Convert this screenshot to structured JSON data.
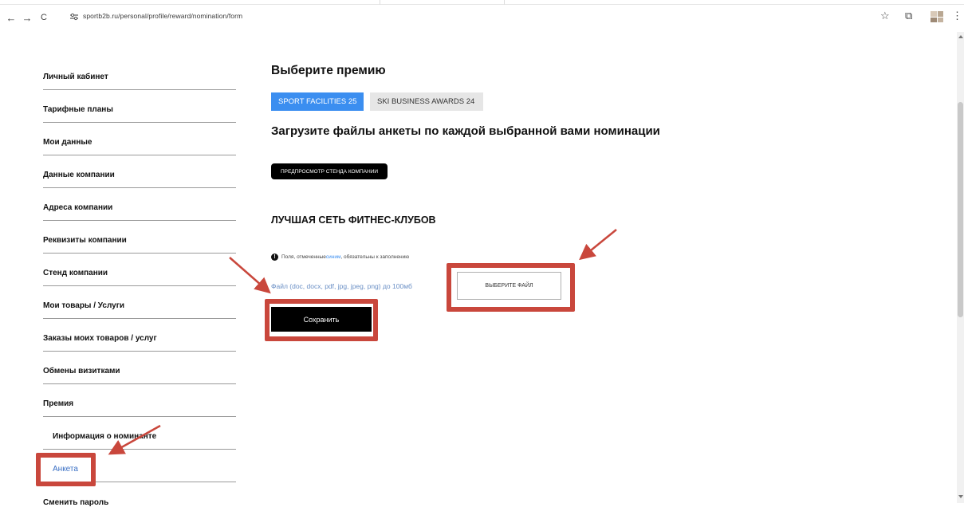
{
  "browser": {
    "url": "sportb2b.ru/personal/profile/reward/nomination/form",
    "back_icon": "←",
    "forward_icon": "→",
    "reload_icon": "C",
    "star_icon": "☆",
    "extensions_icon": "⧉",
    "menu_icon": "⋮"
  },
  "sidebar": {
    "items": [
      {
        "label": "Личный кабинет"
      },
      {
        "label": "Тарифные планы"
      },
      {
        "label": "Мои данные"
      },
      {
        "label": "Данные компании"
      },
      {
        "label": "Адреса компании"
      },
      {
        "label": "Реквизиты компании"
      },
      {
        "label": "Стенд компании"
      },
      {
        "label": "Мои товары / Услуги"
      },
      {
        "label": "Заказы моих товаров / услуг"
      },
      {
        "label": "Обмены визитками"
      },
      {
        "label": "Премия"
      },
      {
        "label": "Информация о номинанте"
      },
      {
        "label": "Анкета"
      },
      {
        "label": "Сменить пароль"
      }
    ]
  },
  "main": {
    "title": "Выберите премию",
    "tabs": [
      {
        "label": "SPORT FACILITIES 25",
        "active": true
      },
      {
        "label": "SKI BUSINESS AWARDS 24",
        "active": false
      }
    ],
    "upload_heading": "Загрузите файлы анкеты по каждой выбранной вами номинации",
    "preview_button": "ПРЕДПРОСМОТР СТЕНДА КОМПАНИИ",
    "nomination_title": "ЛУЧШАЯ СЕТЬ ФИТНЕС-КЛУБОВ",
    "note": {
      "icon": "!",
      "prefix": "Поля, отмеченные ",
      "blue_word": "синим",
      "suffix": ", обязательны к заполнению"
    },
    "file_label": "Файл (doc, docx, pdf, jpg, jpeg, png) до 100мб",
    "file_button": "ВЫБЕРИТЕ ФАЙЛ",
    "save_button": "Сохранить"
  },
  "colors": {
    "accent": "#3b8ef0",
    "highlight": "#c9473c",
    "active_link": "#3a6fc4"
  }
}
